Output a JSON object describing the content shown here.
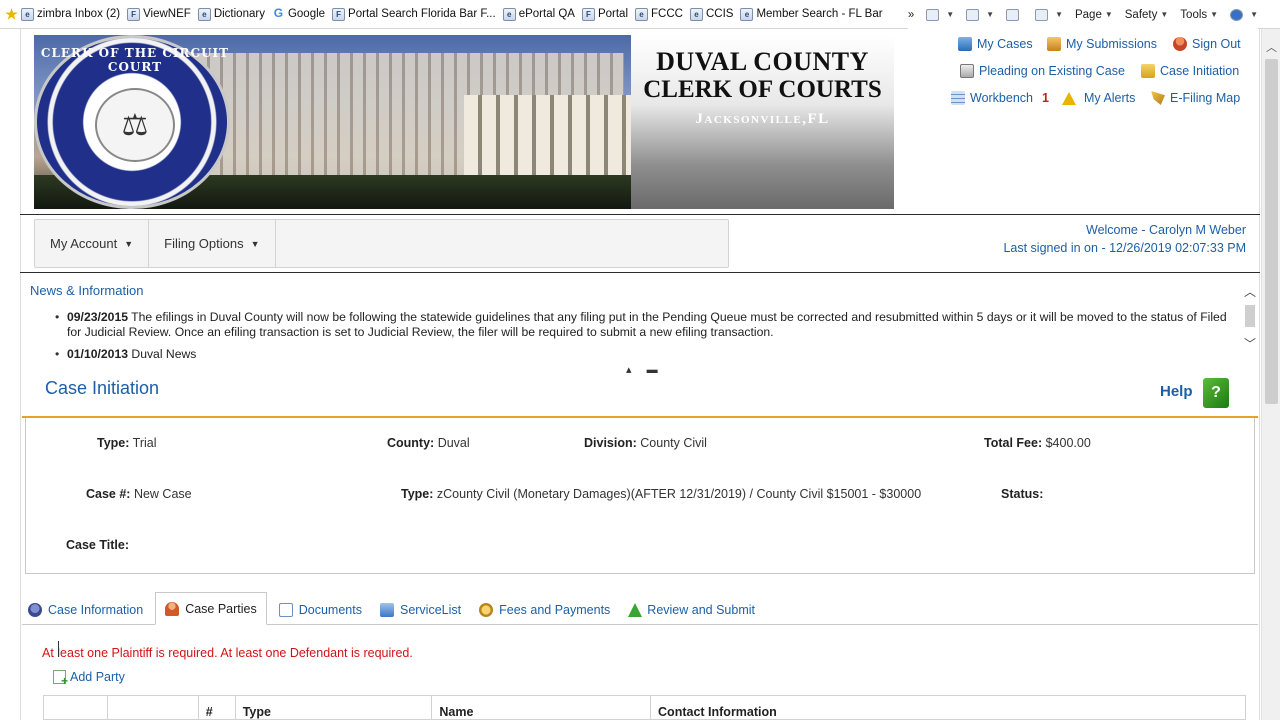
{
  "favorites": [
    {
      "label": "zimbra Inbox (2)",
      "icon": "ie-page-icon"
    },
    {
      "label": "ViewNEF",
      "icon": "fcc-icon"
    },
    {
      "label": "Dictionary",
      "icon": "ie-page-icon"
    },
    {
      "label": "Google",
      "icon": "google-icon"
    },
    {
      "label": "Portal Search Florida Bar F...",
      "icon": "fcc-icon"
    },
    {
      "label": "ePortal QA",
      "icon": "ie-page-icon"
    },
    {
      "label": "Portal",
      "icon": "fcc-icon"
    },
    {
      "label": "FCCC",
      "icon": "ie-page-icon"
    },
    {
      "label": "CCIS",
      "icon": "ie-page-icon"
    },
    {
      "label": "Member Search - FL Bar",
      "icon": "ie-page-icon"
    }
  ],
  "ie_toolbar": {
    "page": "Page",
    "safety": "Safety",
    "tools": "Tools"
  },
  "banner": {
    "line1": "DUVAL COUNTY",
    "line2": "CLERK OF COURTS",
    "line3": "Jacksonville,FL",
    "seal_text": "CLERK OF THE CIRCUIT COURT"
  },
  "nav": {
    "my_cases": "My Cases",
    "my_submissions": "My Submissions",
    "sign_out": "Sign Out",
    "pleading": "Pleading on Existing Case",
    "case_initiation": "Case Initiation",
    "workbench": "Workbench",
    "workbench_count": "1",
    "my_alerts": "My Alerts",
    "efiling_map": "E-Filing Map"
  },
  "menu": {
    "my_account": "My Account",
    "filing_options": "Filing Options"
  },
  "welcome": {
    "line1": "Welcome - Carolyn M Weber",
    "line2": "Last signed in on - 12/26/2019 02:07:33 PM"
  },
  "news": {
    "title": "News & Information",
    "items": [
      {
        "date": "09/23/2015",
        "text": " The efilings in Duval County will now be following the statewide guidelines that any filing put in the Pending Queue must be corrected and resubmitted within 5 days or it will be moved to the status of Filed for Judicial Review. Once an efiling transaction is set to Judicial Review, the filer will be required to submit a new efiling transaction."
      },
      {
        "date": "01/10/2013",
        "text": " Duval News"
      }
    ]
  },
  "case": {
    "title": "Case Initiation",
    "help": "Help",
    "type_label": "Type:",
    "type_value": " Trial",
    "county_label": "County:",
    "county_value": " Duval",
    "division_label": "Division:",
    "division_value": " County Civil",
    "fee_label": "Total Fee:",
    "fee_value": " $400.00",
    "casenum_label": "Case #:",
    "casenum_value": " New Case",
    "type2_label": "Type:",
    "type2_value": " zCounty Civil (Monetary Damages)(AFTER 12/31/2019) / County Civil $15001 - $30000",
    "status_label": "Status:",
    "title_label": "Case Title:"
  },
  "tabs": [
    {
      "label": "Case Information",
      "icon": "case-info-icon"
    },
    {
      "label": "Case Parties",
      "icon": "case-parties-icon",
      "active": true
    },
    {
      "label": "Documents",
      "icon": "documents-icon"
    },
    {
      "label": "ServiceList",
      "icon": "servicelist-icon"
    },
    {
      "label": "Fees and Payments",
      "icon": "fees-icon"
    },
    {
      "label": "Review and Submit",
      "icon": "review-icon"
    }
  ],
  "parties": {
    "error": "At least one Plaintiff is required. At least one Defendant is required.",
    "add_party": "Add Party",
    "columns": [
      "",
      "",
      "#",
      "Type",
      "Name",
      "Contact Information"
    ]
  }
}
